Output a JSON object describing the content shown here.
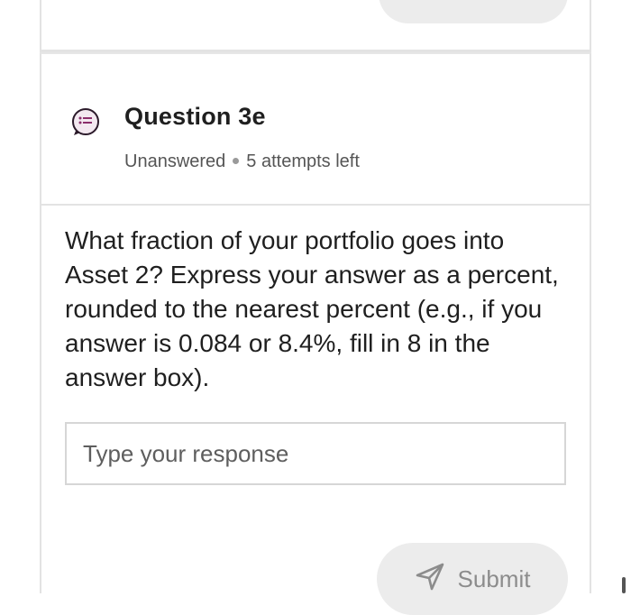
{
  "question": {
    "title": "Question 3e",
    "status": "Unanswered",
    "attempts": "5 attempts left",
    "prompt": "What fraction of your portfolio goes into Asset 2? Express your answer as a percent, rounded to the nearest percent (e.g., if you answer is 0.084 or 8.4%, fill in 8 in the answer box)."
  },
  "response": {
    "placeholder": "Type your response",
    "value": ""
  },
  "submit": {
    "label": "Submit"
  },
  "icons": {
    "question_type": "list-question-icon",
    "submit": "send-arrow-icon"
  },
  "colors": {
    "icon_accent": "#8a2d6b",
    "button_bg": "#ececec",
    "border": "#e3e3e3"
  }
}
